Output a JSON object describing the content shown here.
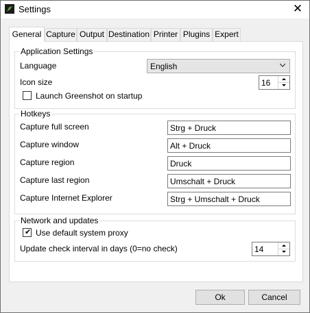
{
  "window": {
    "title": "Settings",
    "close_glyph": "✕",
    "icon": "greenshot-app-icon"
  },
  "tabs": [
    {
      "label": "General",
      "active": true
    },
    {
      "label": "Capture"
    },
    {
      "label": "Output"
    },
    {
      "label": "Destination"
    },
    {
      "label": "Printer"
    },
    {
      "label": "Plugins"
    },
    {
      "label": "Expert"
    }
  ],
  "application_settings": {
    "title": "Application Settings",
    "language_label": "Language",
    "language_value": "English",
    "icon_size_label": "Icon size",
    "icon_size_value": "16",
    "launch_label": "Launch Greenshot on startup",
    "launch_checked": false
  },
  "hotkeys": {
    "title": "Hotkeys",
    "rows": [
      {
        "label": "Capture full screen",
        "value": "Strg + Druck"
      },
      {
        "label": "Capture window",
        "value": "Alt + Druck"
      },
      {
        "label": "Capture region",
        "value": "Druck"
      },
      {
        "label": "Capture last region",
        "value": "Umschalt + Druck"
      },
      {
        "label": "Capture Internet Explorer",
        "value": "Strg + Umschalt + Druck"
      }
    ]
  },
  "network": {
    "title": "Network and updates",
    "proxy_label": "Use default system proxy",
    "proxy_checked": true,
    "check_mark": "✔",
    "interval_label": "Update check interval in days (0=no check)",
    "interval_value": "14"
  },
  "buttons": {
    "ok": "Ok",
    "cancel": "Cancel"
  }
}
